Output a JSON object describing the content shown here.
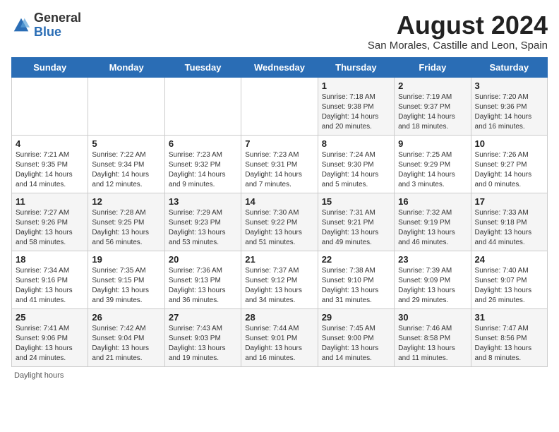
{
  "header": {
    "logo_general": "General",
    "logo_blue": "Blue",
    "title": "August 2024",
    "subtitle": "San Morales, Castille and Leon, Spain"
  },
  "weekdays": [
    "Sunday",
    "Monday",
    "Tuesday",
    "Wednesday",
    "Thursday",
    "Friday",
    "Saturday"
  ],
  "weeks": [
    [
      {
        "day": "",
        "info": ""
      },
      {
        "day": "",
        "info": ""
      },
      {
        "day": "",
        "info": ""
      },
      {
        "day": "",
        "info": ""
      },
      {
        "day": "1",
        "info": "Sunrise: 7:18 AM\nSunset: 9:38 PM\nDaylight: 14 hours and 20 minutes."
      },
      {
        "day": "2",
        "info": "Sunrise: 7:19 AM\nSunset: 9:37 PM\nDaylight: 14 hours and 18 minutes."
      },
      {
        "day": "3",
        "info": "Sunrise: 7:20 AM\nSunset: 9:36 PM\nDaylight: 14 hours and 16 minutes."
      }
    ],
    [
      {
        "day": "4",
        "info": "Sunrise: 7:21 AM\nSunset: 9:35 PM\nDaylight: 14 hours and 14 minutes."
      },
      {
        "day": "5",
        "info": "Sunrise: 7:22 AM\nSunset: 9:34 PM\nDaylight: 14 hours and 12 minutes."
      },
      {
        "day": "6",
        "info": "Sunrise: 7:23 AM\nSunset: 9:32 PM\nDaylight: 14 hours and 9 minutes."
      },
      {
        "day": "7",
        "info": "Sunrise: 7:23 AM\nSunset: 9:31 PM\nDaylight: 14 hours and 7 minutes."
      },
      {
        "day": "8",
        "info": "Sunrise: 7:24 AM\nSunset: 9:30 PM\nDaylight: 14 hours and 5 minutes."
      },
      {
        "day": "9",
        "info": "Sunrise: 7:25 AM\nSunset: 9:29 PM\nDaylight: 14 hours and 3 minutes."
      },
      {
        "day": "10",
        "info": "Sunrise: 7:26 AM\nSunset: 9:27 PM\nDaylight: 14 hours and 0 minutes."
      }
    ],
    [
      {
        "day": "11",
        "info": "Sunrise: 7:27 AM\nSunset: 9:26 PM\nDaylight: 13 hours and 58 minutes."
      },
      {
        "day": "12",
        "info": "Sunrise: 7:28 AM\nSunset: 9:25 PM\nDaylight: 13 hours and 56 minutes."
      },
      {
        "day": "13",
        "info": "Sunrise: 7:29 AM\nSunset: 9:23 PM\nDaylight: 13 hours and 53 minutes."
      },
      {
        "day": "14",
        "info": "Sunrise: 7:30 AM\nSunset: 9:22 PM\nDaylight: 13 hours and 51 minutes."
      },
      {
        "day": "15",
        "info": "Sunrise: 7:31 AM\nSunset: 9:21 PM\nDaylight: 13 hours and 49 minutes."
      },
      {
        "day": "16",
        "info": "Sunrise: 7:32 AM\nSunset: 9:19 PM\nDaylight: 13 hours and 46 minutes."
      },
      {
        "day": "17",
        "info": "Sunrise: 7:33 AM\nSunset: 9:18 PM\nDaylight: 13 hours and 44 minutes."
      }
    ],
    [
      {
        "day": "18",
        "info": "Sunrise: 7:34 AM\nSunset: 9:16 PM\nDaylight: 13 hours and 41 minutes."
      },
      {
        "day": "19",
        "info": "Sunrise: 7:35 AM\nSunset: 9:15 PM\nDaylight: 13 hours and 39 minutes."
      },
      {
        "day": "20",
        "info": "Sunrise: 7:36 AM\nSunset: 9:13 PM\nDaylight: 13 hours and 36 minutes."
      },
      {
        "day": "21",
        "info": "Sunrise: 7:37 AM\nSunset: 9:12 PM\nDaylight: 13 hours and 34 minutes."
      },
      {
        "day": "22",
        "info": "Sunrise: 7:38 AM\nSunset: 9:10 PM\nDaylight: 13 hours and 31 minutes."
      },
      {
        "day": "23",
        "info": "Sunrise: 7:39 AM\nSunset: 9:09 PM\nDaylight: 13 hours and 29 minutes."
      },
      {
        "day": "24",
        "info": "Sunrise: 7:40 AM\nSunset: 9:07 PM\nDaylight: 13 hours and 26 minutes."
      }
    ],
    [
      {
        "day": "25",
        "info": "Sunrise: 7:41 AM\nSunset: 9:06 PM\nDaylight: 13 hours and 24 minutes."
      },
      {
        "day": "26",
        "info": "Sunrise: 7:42 AM\nSunset: 9:04 PM\nDaylight: 13 hours and 21 minutes."
      },
      {
        "day": "27",
        "info": "Sunrise: 7:43 AM\nSunset: 9:03 PM\nDaylight: 13 hours and 19 minutes."
      },
      {
        "day": "28",
        "info": "Sunrise: 7:44 AM\nSunset: 9:01 PM\nDaylight: 13 hours and 16 minutes."
      },
      {
        "day": "29",
        "info": "Sunrise: 7:45 AM\nSunset: 9:00 PM\nDaylight: 13 hours and 14 minutes."
      },
      {
        "day": "30",
        "info": "Sunrise: 7:46 AM\nSunset: 8:58 PM\nDaylight: 13 hours and 11 minutes."
      },
      {
        "day": "31",
        "info": "Sunrise: 7:47 AM\nSunset: 8:56 PM\nDaylight: 13 hours and 8 minutes."
      }
    ]
  ],
  "footer": "Daylight hours"
}
